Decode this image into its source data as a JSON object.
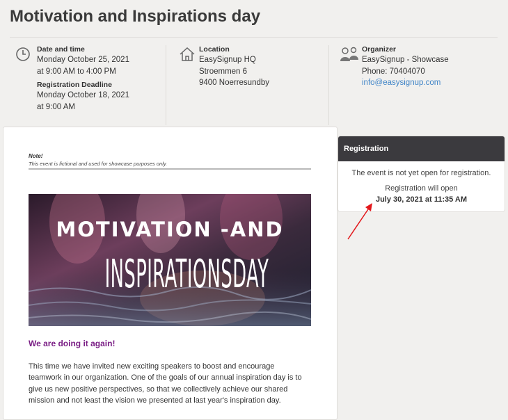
{
  "page": {
    "title": "Motivation and Inspirations day"
  },
  "info": {
    "datetime": {
      "icon": "clock-icon",
      "label": "Date and time",
      "date": "Monday October 25, 2021",
      "time": "at 9:00 AM to 4:00 PM",
      "deadline_label": "Registration Deadline",
      "deadline_date": "Monday October 18, 2021",
      "deadline_time": "at 9:00 AM"
    },
    "location": {
      "icon": "house-icon",
      "label": "Location",
      "line1": "EasySignup HQ",
      "line2": "Stroemmen 6",
      "line3": "9400 Noerresundby"
    },
    "organizer": {
      "icon": "people-icon",
      "label": "Organizer",
      "name": "EasySignup - Showcase",
      "phone": "Phone: 70404070",
      "email": "info@easysignup.com"
    }
  },
  "content": {
    "note_title": "Note!",
    "note_text": "This event is fictional and used for showcase purposes only.",
    "banner_line1": "MOTIVATION -AND",
    "banner_line2": "INSPIRATIONSDAY",
    "subheading": "We are doing it again!",
    "paragraph": "This time we have invited new exciting speakers to boost and encourage teamwork in our organization. One of the goals of our annual inspiration day is to give us new positive perspectives, so that we collectively achieve our shared mission and not least the vision we presented at last year's inspiration day."
  },
  "registration": {
    "header": "Registration",
    "status": "The event is not yet open for registration.",
    "opens_label": "Registration will open",
    "opens_date": "July 30, 2021 at 11:35 AM"
  },
  "colors": {
    "accent_purple": "#7a1e85",
    "link_blue": "#3f84c7",
    "header_dark": "#3b3a3e",
    "annotation_red": "#e3171b"
  }
}
